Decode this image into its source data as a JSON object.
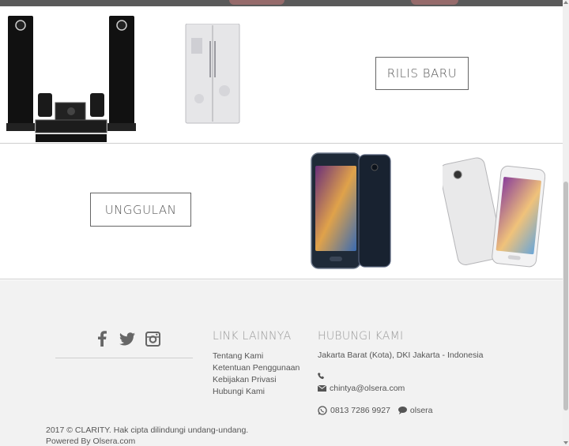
{
  "categories": {
    "new_release_label": "RILIS BARU",
    "featured_label": "UNGGULAN"
  },
  "products": {
    "speaker_system": "speaker-system",
    "refrigerator": "refrigerator",
    "phone_dark": "smartphone-dark",
    "phone_white": "smartphone-white"
  },
  "footer": {
    "social": [
      "facebook-icon",
      "twitter-icon",
      "instagram-icon"
    ],
    "links_title": "LINK LAINNYA",
    "links": [
      "Tentang Kami",
      "Ketentuan Penggunaan",
      "Kebijakan Privasi",
      "Hubungi Kami"
    ],
    "contact_title": "HUBUNGI KAMI",
    "address": "Jakarta Barat (Kota), DKI Jakarta - Indonesia",
    "phone": "",
    "email": "chintya@olsera.com",
    "whatsapp": "0813 7286 9927",
    "chat": "olsera",
    "copyright": "2017 © CLARITY. Hak cipta dilindungi undang-undang. Powered By Olsera.com"
  },
  "colors": {
    "footer_bg": "#f2f2f2",
    "accent_text": "#999999"
  }
}
